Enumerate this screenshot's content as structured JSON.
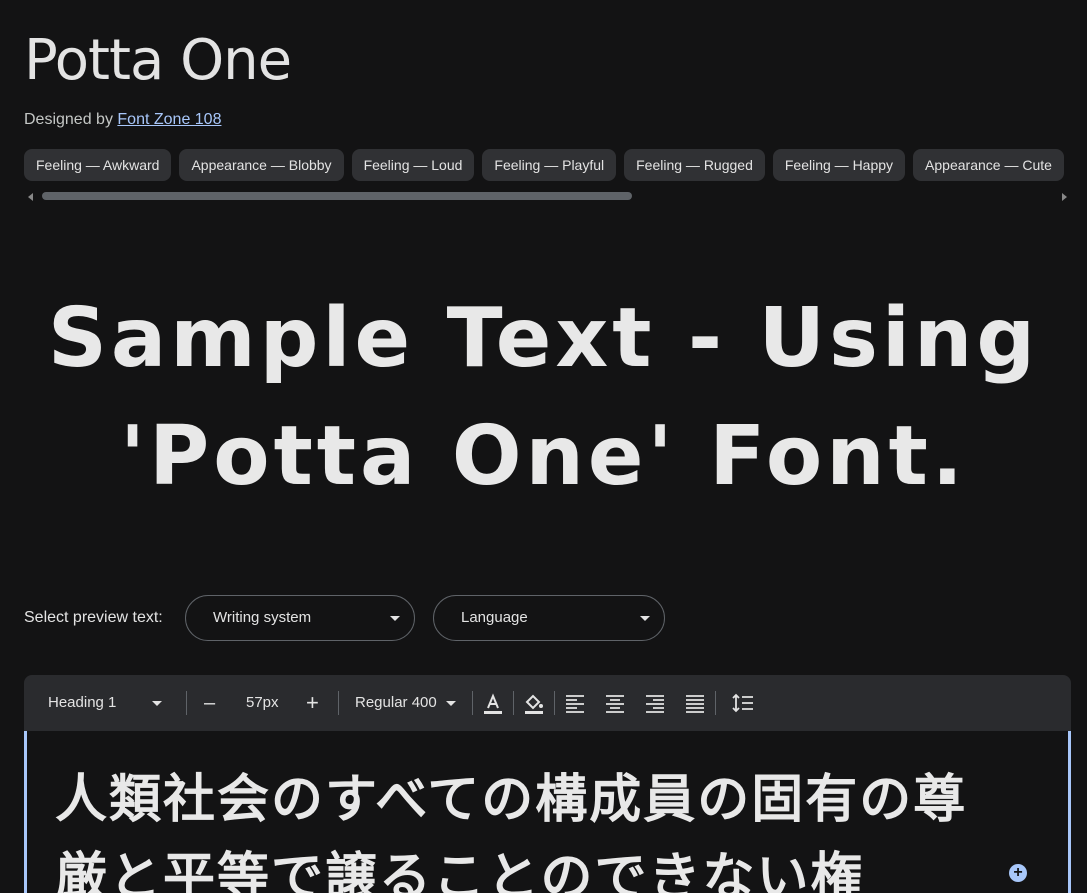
{
  "header": {
    "title": "Potta One",
    "designed_by_label": "Designed by",
    "designer": "Font Zone 108"
  },
  "tags": [
    "Feeling — Awkward",
    "Appearance — Blobby",
    "Feeling — Loud",
    "Feeling — Playful",
    "Feeling — Rugged",
    "Feeling — Happy",
    "Appearance — Cute"
  ],
  "sample_text": "Sample Text - Using 'Potta One' Font.",
  "preview": {
    "label": "Select preview text:",
    "writing_system": "Writing system",
    "language": "Language"
  },
  "toolbar": {
    "style": "Heading 1",
    "size": "57px",
    "minus": "–",
    "plus": "+",
    "weight": "Regular 400"
  },
  "editor": {
    "text": "人類社会のすべての構成員の固有の尊厳と平等で譲ることのできない権"
  },
  "colors": {
    "background": "#131314",
    "chip": "#303134",
    "link": "#a8c7fa",
    "toolbar": "#2a2b2e"
  }
}
